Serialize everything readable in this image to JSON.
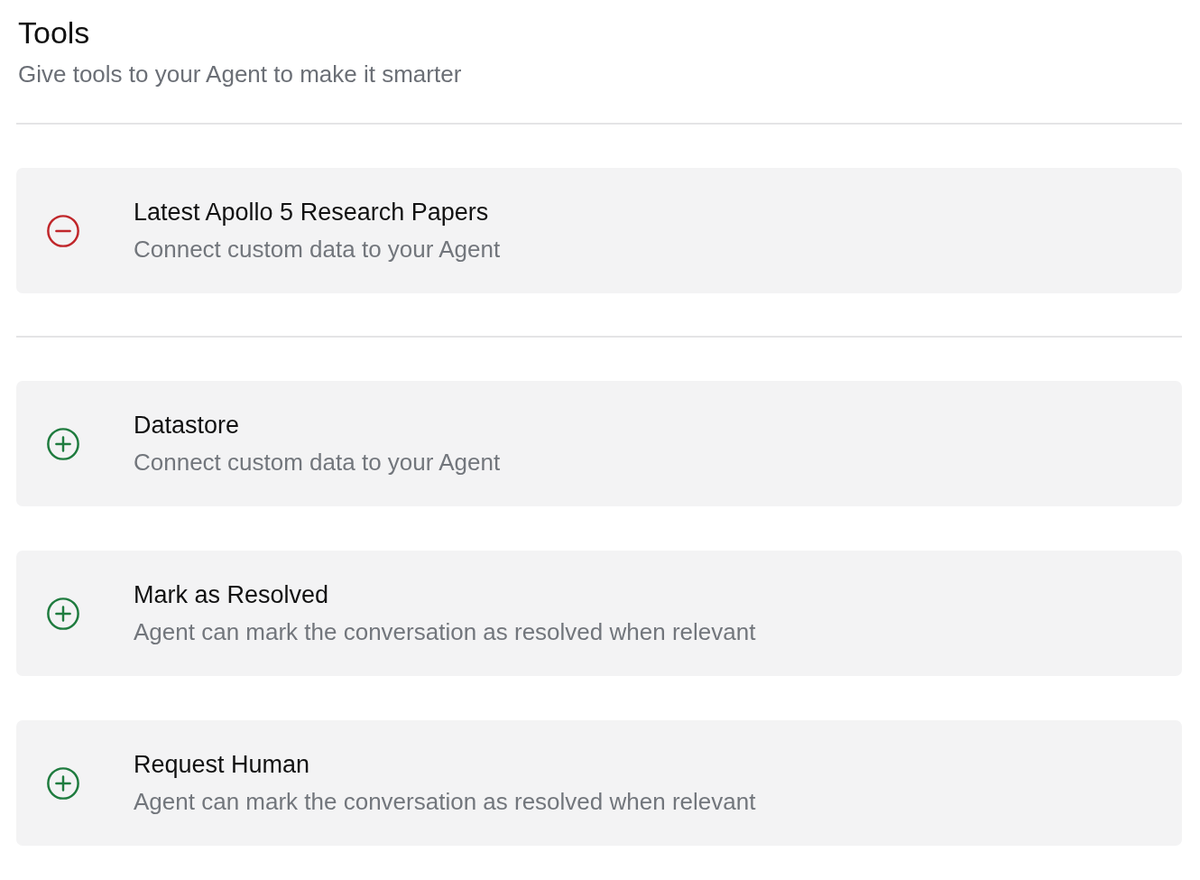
{
  "header": {
    "title": "Tools",
    "subtitle": "Give tools to your Agent to make it smarter"
  },
  "added_tools": [
    {
      "name": "Latest Apollo 5 Research Papers",
      "description": "Connect custom data to your Agent"
    }
  ],
  "available_tools": [
    {
      "name": "Datastore",
      "description": "Connect custom data to your Agent"
    },
    {
      "name": "Mark as Resolved",
      "description": "Agent can mark the conversation as resolved when relevant"
    },
    {
      "name": "Request Human",
      "description": "Agent can mark the conversation as resolved when relevant"
    }
  ]
}
